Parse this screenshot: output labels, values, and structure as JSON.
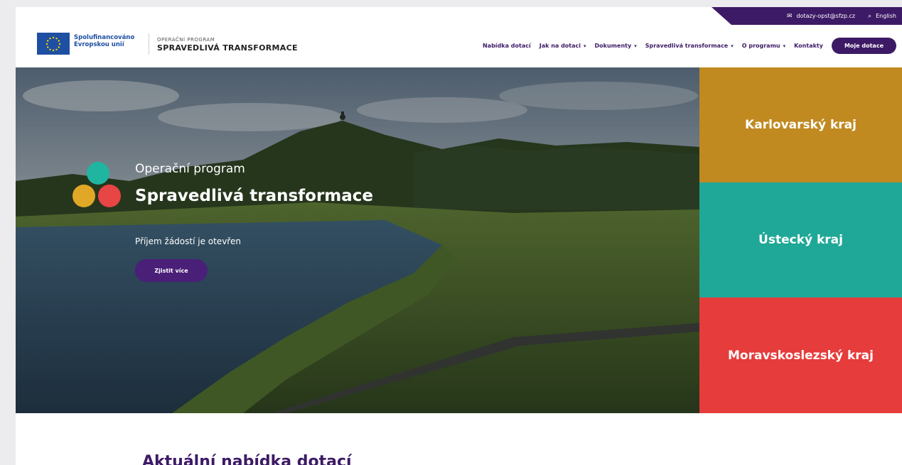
{
  "utility": {
    "email": "dotazy-opst@sfzp.cz",
    "language": "English"
  },
  "logo": {
    "eu_line1": "Spolufinancováno",
    "eu_line2": "Evropskou unií",
    "op_small": "OPERAČNÍ PROGRAM",
    "op_big": "SPRAVEDLIVÁ TRANSFORMACE"
  },
  "nav": {
    "items": [
      {
        "label": "Nabídka dotací",
        "dropdown": false
      },
      {
        "label": "Jak na dotaci",
        "dropdown": true
      },
      {
        "label": "Dokumenty",
        "dropdown": true
      },
      {
        "label": "Spravedlivá transformace",
        "dropdown": true
      },
      {
        "label": "O programu",
        "dropdown": true
      },
      {
        "label": "Kontakty",
        "dropdown": false
      }
    ],
    "cta": "Moje dotace"
  },
  "hero": {
    "subtitle": "Operační program",
    "title": "Spravedlivá transformace",
    "status": "Příjem žádostí je otevřen",
    "button": "Zjistit více"
  },
  "regions": [
    {
      "label": "Karlovarský kraj",
      "color": "#c08a20"
    },
    {
      "label": "Ústecký kraj",
      "color": "#1fa897"
    },
    {
      "label": "Moravskoslezský kraj",
      "color": "#e63c3c"
    }
  ],
  "section": {
    "title": "Aktuální nabídka dotací"
  },
  "colors": {
    "brand": "#3d1a66",
    "eu_blue": "#1e4fa3",
    "dot_teal": "#1fb5a0",
    "dot_gold": "#e0a826",
    "dot_red": "#e84545"
  }
}
